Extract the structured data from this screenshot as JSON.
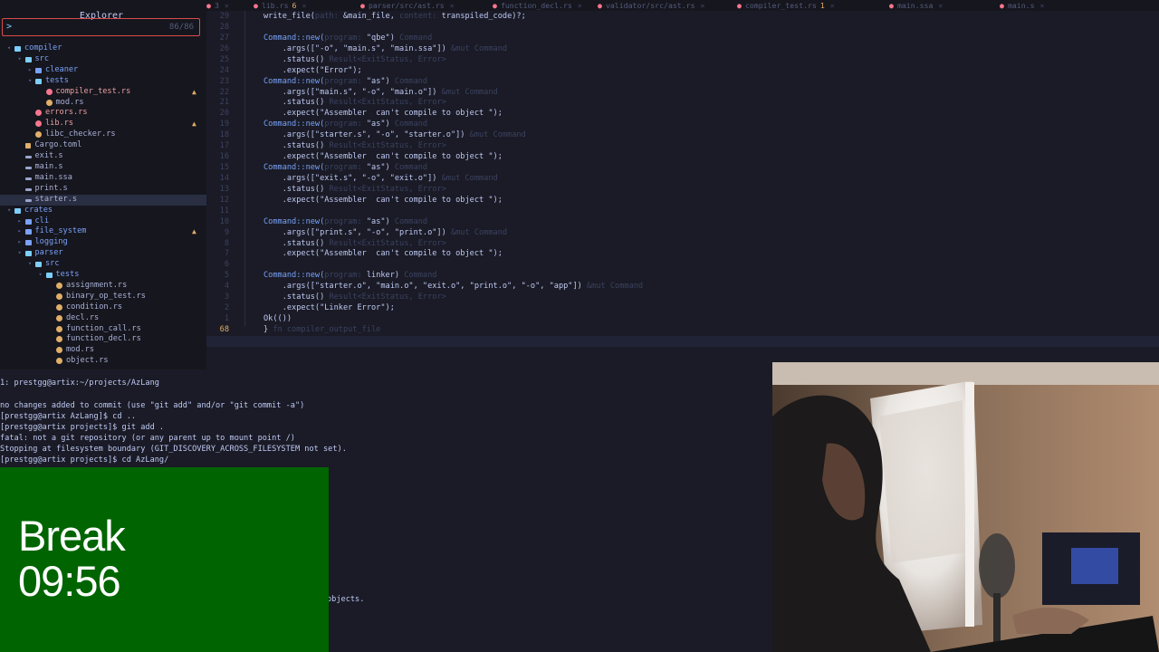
{
  "explorer": {
    "title": "Explorer",
    "search_prompt": ">",
    "search_count": "86/86",
    "tree": [
      {
        "label": "compiler",
        "depth": 1,
        "kind": "folder-open",
        "expanded": true
      },
      {
        "label": "src",
        "depth": 2,
        "kind": "folder-open",
        "expanded": true
      },
      {
        "label": "cleaner",
        "depth": 3,
        "kind": "folder",
        "expanded": false
      },
      {
        "label": "tests",
        "depth": 3,
        "kind": "folder-open",
        "expanded": true
      },
      {
        "label": "compiler_test.rs",
        "depth": 4,
        "kind": "rust-err",
        "warning": true
      },
      {
        "label": "mod.rs",
        "depth": 4,
        "kind": "rust"
      },
      {
        "label": "errors.rs",
        "depth": 3,
        "kind": "rust-err"
      },
      {
        "label": "lib.rs",
        "depth": 3,
        "kind": "rust-err",
        "warning": true
      },
      {
        "label": "libc_checker.rs",
        "depth": 3,
        "kind": "rust"
      },
      {
        "label": "Cargo.toml",
        "depth": 2,
        "kind": "toml"
      },
      {
        "label": "exit.s",
        "depth": 2,
        "kind": "asm"
      },
      {
        "label": "main.s",
        "depth": 2,
        "kind": "asm"
      },
      {
        "label": "main.ssa",
        "depth": 2,
        "kind": "asm"
      },
      {
        "label": "print.s",
        "depth": 2,
        "kind": "asm"
      },
      {
        "label": "starter.s",
        "depth": 2,
        "kind": "asm",
        "selected": true
      },
      {
        "label": "crates",
        "depth": 1,
        "kind": "folder-open",
        "expanded": true
      },
      {
        "label": "cli",
        "depth": 2,
        "kind": "folder",
        "expanded": false
      },
      {
        "label": "file_system",
        "depth": 2,
        "kind": "folder",
        "expanded": false,
        "warning": true
      },
      {
        "label": "logging",
        "depth": 2,
        "kind": "folder",
        "expanded": false
      },
      {
        "label": "parser",
        "depth": 2,
        "kind": "folder-open",
        "expanded": true
      },
      {
        "label": "src",
        "depth": 3,
        "kind": "folder-open",
        "expanded": true
      },
      {
        "label": "tests",
        "depth": 4,
        "kind": "folder-open",
        "expanded": true
      },
      {
        "label": "assignment.rs",
        "depth": 5,
        "kind": "rust"
      },
      {
        "label": "binary_op_test.rs",
        "depth": 5,
        "kind": "rust"
      },
      {
        "label": "condition.rs",
        "depth": 5,
        "kind": "rust"
      },
      {
        "label": "decl.rs",
        "depth": 5,
        "kind": "rust"
      },
      {
        "label": "function_call.rs",
        "depth": 5,
        "kind": "rust"
      },
      {
        "label": "function_decl.rs",
        "depth": 5,
        "kind": "rust"
      },
      {
        "label": "mod.rs",
        "depth": 5,
        "kind": "rust"
      },
      {
        "label": "object.rs",
        "depth": 5,
        "kind": "rust"
      }
    ]
  },
  "tabs": [
    {
      "label": "3",
      "icon": ""
    },
    {
      "label": "lib.rs",
      "suffix": "6"
    },
    {
      "label": "parser/src/ast.rs"
    },
    {
      "label": "function_decl.rs"
    },
    {
      "label": "validator/src/ast.rs"
    },
    {
      "label": "compiler_test.rs",
      "suffix": "1",
      "active": true
    },
    {
      "label": "main.ssa"
    },
    {
      "label": "main.s"
    }
  ],
  "editor": {
    "lines": [
      {
        "ln": "29",
        "parts": [
          [
            "write_file(",
            ""
          ],
          [
            "path: ",
            "hint"
          ],
          [
            "&main_file, ",
            ""
          ],
          [
            "content: ",
            "hint"
          ],
          [
            "transpiled_code)?;",
            ""
          ]
        ]
      },
      {
        "ln": "28",
        "parts": []
      },
      {
        "ln": "27",
        "parts": [
          [
            "Command::new(",
            "kw"
          ],
          [
            "program: ",
            "hint"
          ],
          [
            "\"qbe\")",
            ""
          ],
          [
            " Command",
            "hint"
          ]
        ]
      },
      {
        "ln": "26",
        "parts": [
          [
            "    .args([\"-o\", \"main.s\", \"main.ssa\"])",
            ""
          ],
          [
            " &mut Command",
            "hint"
          ]
        ]
      },
      {
        "ln": "25",
        "parts": [
          [
            "    .status()",
            ""
          ],
          [
            " Result<ExitStatus, Error>",
            "hint"
          ]
        ]
      },
      {
        "ln": "24",
        "parts": [
          [
            "    .expect(\"Error\");",
            ""
          ]
        ]
      },
      {
        "ln": "23",
        "parts": [
          [
            "Command::new(",
            "kw"
          ],
          [
            "program: ",
            "hint"
          ],
          [
            "\"as\")",
            ""
          ],
          [
            " Command",
            "hint"
          ]
        ]
      },
      {
        "ln": "22",
        "parts": [
          [
            "    .args([\"main.s\", \"-o\", \"main.o\"])",
            ""
          ],
          [
            " &mut Command",
            "hint"
          ]
        ]
      },
      {
        "ln": "21",
        "parts": [
          [
            "    .status()",
            ""
          ],
          [
            " Result<ExitStatus, Error>",
            "hint"
          ]
        ]
      },
      {
        "ln": "20",
        "parts": [
          [
            "    .expect(\"Assembler  can't compile to object \");",
            ""
          ]
        ]
      },
      {
        "ln": "19",
        "parts": [
          [
            "Command::new(",
            "kw"
          ],
          [
            "program: ",
            "hint"
          ],
          [
            "\"as\")",
            ""
          ],
          [
            " Command",
            "hint"
          ]
        ]
      },
      {
        "ln": "18",
        "parts": [
          [
            "    .args([\"starter.s\", \"-o\", \"starter.o\"])",
            ""
          ],
          [
            " &mut Command",
            "hint"
          ]
        ]
      },
      {
        "ln": "17",
        "parts": [
          [
            "    .status()",
            ""
          ],
          [
            " Result<ExitStatus, Error>",
            "hint"
          ]
        ]
      },
      {
        "ln": "16",
        "parts": [
          [
            "    .expect(\"Assembler  can't compile to object \");",
            ""
          ]
        ]
      },
      {
        "ln": "15",
        "parts": [
          [
            "Command::new(",
            "kw"
          ],
          [
            "program: ",
            "hint"
          ],
          [
            "\"as\")",
            ""
          ],
          [
            " Command",
            "hint"
          ]
        ]
      },
      {
        "ln": "14",
        "parts": [
          [
            "    .args([\"exit.s\", \"-o\", \"exit.o\"])",
            ""
          ],
          [
            " &mut Command",
            "hint"
          ]
        ]
      },
      {
        "ln": "13",
        "parts": [
          [
            "    .status()",
            ""
          ],
          [
            " Result<ExitStatus, Error>",
            "hint"
          ]
        ]
      },
      {
        "ln": "12",
        "parts": [
          [
            "    .expect(\"Assembler  can't compile to object \");",
            ""
          ]
        ]
      },
      {
        "ln": "11",
        "parts": []
      },
      {
        "ln": "10",
        "parts": [
          [
            "Command::new(",
            "kw"
          ],
          [
            "program: ",
            "hint"
          ],
          [
            "\"as\")",
            ""
          ],
          [
            " Command",
            "hint"
          ]
        ]
      },
      {
        "ln": "9",
        "parts": [
          [
            "    .args([\"print.s\", \"-o\", \"print.o\"])",
            ""
          ],
          [
            " &mut Command",
            "hint"
          ]
        ]
      },
      {
        "ln": "8",
        "parts": [
          [
            "    .status()",
            ""
          ],
          [
            " Result<ExitStatus, Error>",
            "hint"
          ]
        ]
      },
      {
        "ln": "7",
        "parts": [
          [
            "    .expect(\"Assembler  can't compile to object \");",
            ""
          ]
        ]
      },
      {
        "ln": "6",
        "parts": []
      },
      {
        "ln": "5",
        "parts": [
          [
            "Command::new(",
            "kw"
          ],
          [
            "program: ",
            "hint"
          ],
          [
            "linker)",
            ""
          ],
          [
            " Command",
            "hint"
          ]
        ]
      },
      {
        "ln": "4",
        "parts": [
          [
            "    .args([\"starter.o\", \"main.o\", \"exit.o\", \"print.o\", \"-o\", \"app\"])",
            ""
          ],
          [
            " &mut Command",
            "hint"
          ]
        ]
      },
      {
        "ln": "3",
        "parts": [
          [
            "    .status()",
            ""
          ],
          [
            " Result<ExitStatus, Error>",
            "hint"
          ]
        ]
      },
      {
        "ln": "2",
        "parts": [
          [
            "    .expect(\"Linker Error\");",
            ""
          ]
        ]
      },
      {
        "ln": "1",
        "parts": [
          [
            "Ok(())",
            ""
          ]
        ]
      },
      {
        "ln": "68",
        "parts": [
          [
            "}",
            ""
          ],
          [
            " fn compiler_output_file",
            "hint"
          ]
        ],
        "current": true
      }
    ]
  },
  "terminal": {
    "title": "1: prestgg@artix:~/projects/AzLang",
    "lines": [
      "no changes added to commit (use \"git add\" and/or \"git commit -a\")",
      "[prestgg@artix AzLang]$ cd ..",
      "[prestgg@artix projects]$ git add .",
      "fatal: not a git repository (or any parent up to mount point /)",
      "Stopping at filesystem boundary (GIT_DISCOVERY_ACROSS_FILESYSTEM not set).",
      "[prestgg@artix projects]$ cd AzLang/"
    ],
    "partial_line": "objects."
  },
  "break_overlay": {
    "label": "Break",
    "time": "09:56",
    "color": "#006400"
  }
}
